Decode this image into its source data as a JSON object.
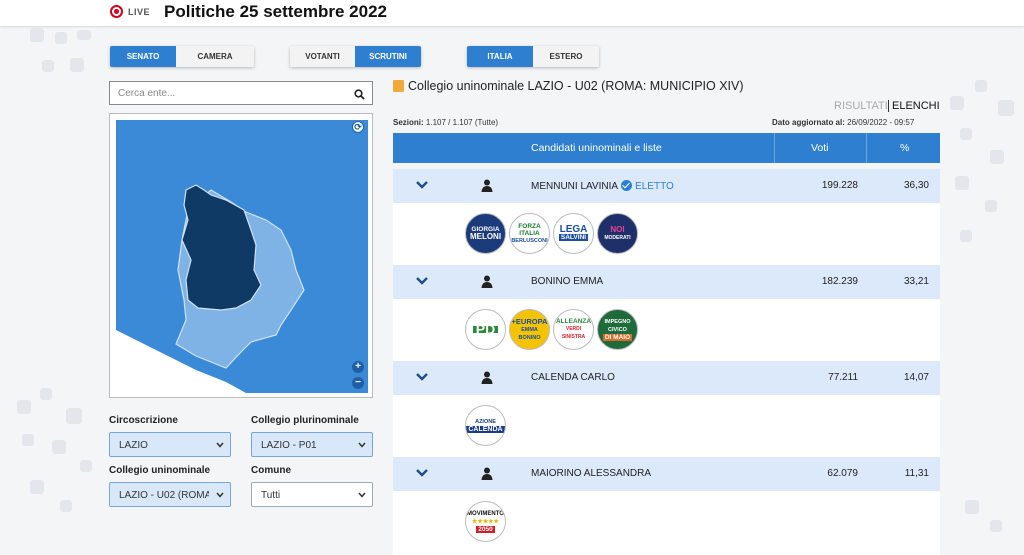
{
  "header": {
    "live_label": "LIVE",
    "title": "Politiche 25 settembre 2022"
  },
  "toggles": {
    "chamber": [
      {
        "label": "SENATO",
        "active": true
      },
      {
        "label": "CAMERA",
        "active": false
      }
    ],
    "mode": [
      {
        "label": "VOTANTI",
        "active": false
      },
      {
        "label": "SCRUTINI",
        "active": true
      }
    ],
    "area": [
      {
        "label": "ITALIA",
        "active": true
      },
      {
        "label": "ESTERO",
        "active": false
      }
    ]
  },
  "search": {
    "placeholder": "Cerca ente..."
  },
  "filters": {
    "circoscrizione_label": "Circoscrizione",
    "circoscrizione_value": "LAZIO",
    "plurinominale_label": "Collegio plurinominale",
    "plurinominale_value": "LAZIO - P01",
    "uninominale_label": "Collegio uninominale",
    "uninominale_value": "LAZIO - U02 (ROMA:",
    "comune_label": "Comune",
    "comune_value": "Tutti"
  },
  "results": {
    "title": "Collegio uninominale LAZIO - U02 (ROMA: MUNICIPIO XIV)",
    "tab_risultati": "RISULTATI",
    "tab_elenchi": "ELENCHI",
    "sezioni_label": "Sezioni:",
    "sezioni_value": "1.107 / 1.107 (Tutte)",
    "updated_label": "Dato aggiornato al:",
    "updated_value": "26/09/2022 - 09:57",
    "headers": {
      "candidates": "Candidati uninominali e liste",
      "votes": "Voti",
      "pct": "%"
    },
    "candidates": [
      {
        "name": "MENNUNI LAVINIA",
        "status": "ELETTO",
        "votes": "199.228",
        "pct": "36,30",
        "lists": [
          [
            "GIORGIA",
            "MELONI"
          ],
          [
            "FORZA ITALIA",
            "BERLUSCONI"
          ],
          [
            "LEGA",
            "SALVINI"
          ],
          [
            "NOI",
            "MODERATI"
          ]
        ]
      },
      {
        "name": "BONINO EMMA",
        "status": "",
        "votes": "182.239",
        "pct": "33,21",
        "lists": [
          [
            "PD",
            ""
          ],
          [
            "+EUROPA",
            "EMMA BONINO"
          ],
          [
            "ALLEANZA",
            "VERDI SINISTRA"
          ],
          [
            "IMPEGNO CIVICO",
            "DI MAIO"
          ]
        ]
      },
      {
        "name": "CALENDA CARLO",
        "status": "",
        "votes": "77.211",
        "pct": "14,07",
        "lists": [
          [
            "AZIONE",
            "CALENDA"
          ]
        ]
      },
      {
        "name": "MAIORINO ALESSANDRA",
        "status": "",
        "votes": "62.079",
        "pct": "11,31",
        "lists": [
          [
            "MOVIMENTO",
            "2050"
          ]
        ]
      }
    ]
  },
  "colors": {
    "accent": "#2e7fd0",
    "row_bg": "#dbe9fb",
    "map_dark": "#0f3a66",
    "map_light": "#7fb3e6",
    "map_bg": "#3b8ad8"
  }
}
